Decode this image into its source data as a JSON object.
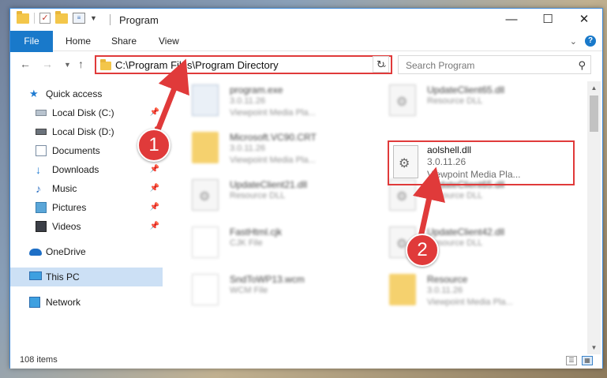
{
  "window": {
    "title": "Program",
    "controls": {
      "minimize": "—",
      "maximize": "☐",
      "close": "✕"
    }
  },
  "ribbon": {
    "tabs": [
      {
        "label": "File"
      },
      {
        "label": "Home"
      },
      {
        "label": "Share"
      },
      {
        "label": "View"
      }
    ]
  },
  "nav": {
    "address": "C:\\Program Files\\Program Directory",
    "search_placeholder": "Search Program"
  },
  "sidebar": {
    "items": [
      {
        "label": "Quick access",
        "icon": "star-icon"
      },
      {
        "label": "Local Disk (C:)",
        "icon": "drive-icon",
        "pinned": true
      },
      {
        "label": "Local Disk (D:)",
        "icon": "drive-icon",
        "pinned": true
      },
      {
        "label": "Documents",
        "icon": "documents-icon",
        "pinned": true
      },
      {
        "label": "Downloads",
        "icon": "download-icon",
        "pinned": true
      },
      {
        "label": "Music",
        "icon": "music-icon",
        "pinned": true
      },
      {
        "label": "Pictures",
        "icon": "pictures-icon",
        "pinned": true
      },
      {
        "label": "Videos",
        "icon": "videos-icon",
        "pinned": true
      },
      {
        "label": "OneDrive",
        "icon": "cloud-icon"
      },
      {
        "label": "This PC",
        "icon": "computer-icon",
        "selected": true
      },
      {
        "label": "Network",
        "icon": "network-icon"
      }
    ]
  },
  "files": [
    {
      "name": "program.exe",
      "line2": "3.0.11.26",
      "line3": "Viewpoint Media Pla...",
      "icon": "exe-icon"
    },
    {
      "name": "UpdateClient65.dll",
      "line2": "Resource DLL",
      "line3": "",
      "icon": "dll-icon"
    },
    {
      "name": "Microsoft.VC90.CRT",
      "line2": "3.0.11.26",
      "line3": "Viewpoint Media Pla...",
      "icon": "folder-icon"
    },
    {
      "name": "aolshell.dll",
      "line2": "3.0.11.26",
      "line3": "Viewpoint Media Pla...",
      "icon": "dll-icon",
      "highlighted": true
    },
    {
      "name": "UpdateClient21.dll",
      "line2": "Resource DLL",
      "line3": "",
      "icon": "dll-icon"
    },
    {
      "name": "UpdateClient65.dll",
      "line2": "Resource DLL",
      "line3": "",
      "icon": "dll-icon"
    },
    {
      "name": "FastHtml.cjk",
      "line2": "CJK File",
      "line3": "",
      "icon": "file-icon"
    },
    {
      "name": "UpdateClient42.dll",
      "line2": "Resource DLL",
      "line3": "",
      "icon": "dll-icon"
    },
    {
      "name": "SndToWP13.wcm",
      "line2": "WCM File",
      "line3": "",
      "icon": "file-icon"
    },
    {
      "name": "Resource",
      "line2": "3.0.11.26",
      "line3": "Viewpoint Media Pla...",
      "icon": "folder-icon"
    }
  ],
  "status": {
    "count": "108 items"
  },
  "annotations": {
    "step1": "1",
    "step2": "2",
    "color": "#e03a3a"
  }
}
